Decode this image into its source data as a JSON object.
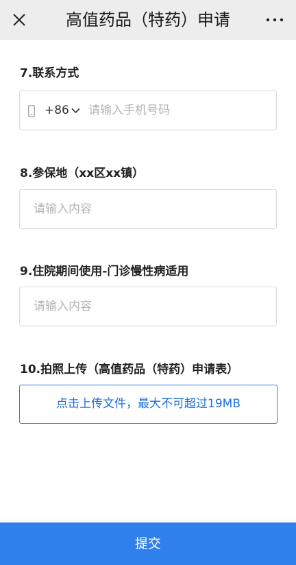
{
  "header": {
    "title": "高值药品（特药）申请",
    "close_icon": "close-icon",
    "more_icon": "more-icon"
  },
  "form": {
    "contact": {
      "label": "7.联系方式",
      "country_code": "+86",
      "placeholder": "请输入手机号码"
    },
    "insured_location": {
      "label": "8.参保地（xx区xx镇）",
      "placeholder": "请输入内容"
    },
    "hospital_use": {
      "label": "9.住院期间使用-门诊慢性病适用",
      "placeholder": "请输入内容"
    },
    "upload": {
      "label": "10.拍照上传（高值药品（特药）申请表）",
      "button_label": "点击上传文件，最大不可超过19MB"
    }
  },
  "footer": {
    "submit_label": "提交"
  },
  "colors": {
    "header_bg": "#ededed",
    "accent": "#2f80ed",
    "placeholder": "#b4b4b4",
    "border": "#d9d9d9"
  }
}
